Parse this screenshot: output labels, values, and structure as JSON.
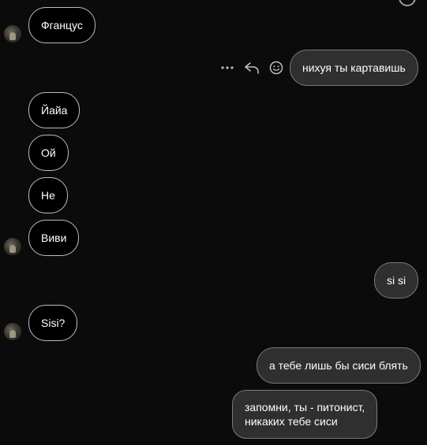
{
  "chat": {
    "messages": [
      {
        "direction": "incoming",
        "text": "Фганцус",
        "avatar": true
      },
      {
        "direction": "outgoing",
        "text": "нихуя ты картавишь",
        "actions": [
          "more-icon",
          "reply-icon",
          "emoji-icon"
        ]
      },
      {
        "direction": "incoming",
        "text": "Йайа",
        "avatar": false
      },
      {
        "direction": "incoming",
        "text": "Ой",
        "avatar": false
      },
      {
        "direction": "incoming",
        "text": "Не",
        "avatar": false
      },
      {
        "direction": "incoming",
        "text": "Виви",
        "avatar": true
      },
      {
        "direction": "outgoing",
        "text": "si si"
      },
      {
        "direction": "incoming",
        "text": "Sisi?",
        "avatar": true
      },
      {
        "direction": "outgoing",
        "text": "а тебе лишь бы сиси блять"
      },
      {
        "direction": "outgoing",
        "text": "запомни, ты - питонист,\nникаких тебе сиси"
      }
    ]
  },
  "hover_actions": {
    "more_icon": "…",
    "reply_icon": "reply-icon",
    "emoji_icon": "emoji-icon"
  },
  "colors": {
    "background": "#0b0b0b",
    "incoming_bubble": "#000000",
    "incoming_border": "#bdbdbd",
    "outgoing_bubble": "#2f2f2f",
    "outgoing_border": "#7a7a7a",
    "text": "#ffffff"
  }
}
